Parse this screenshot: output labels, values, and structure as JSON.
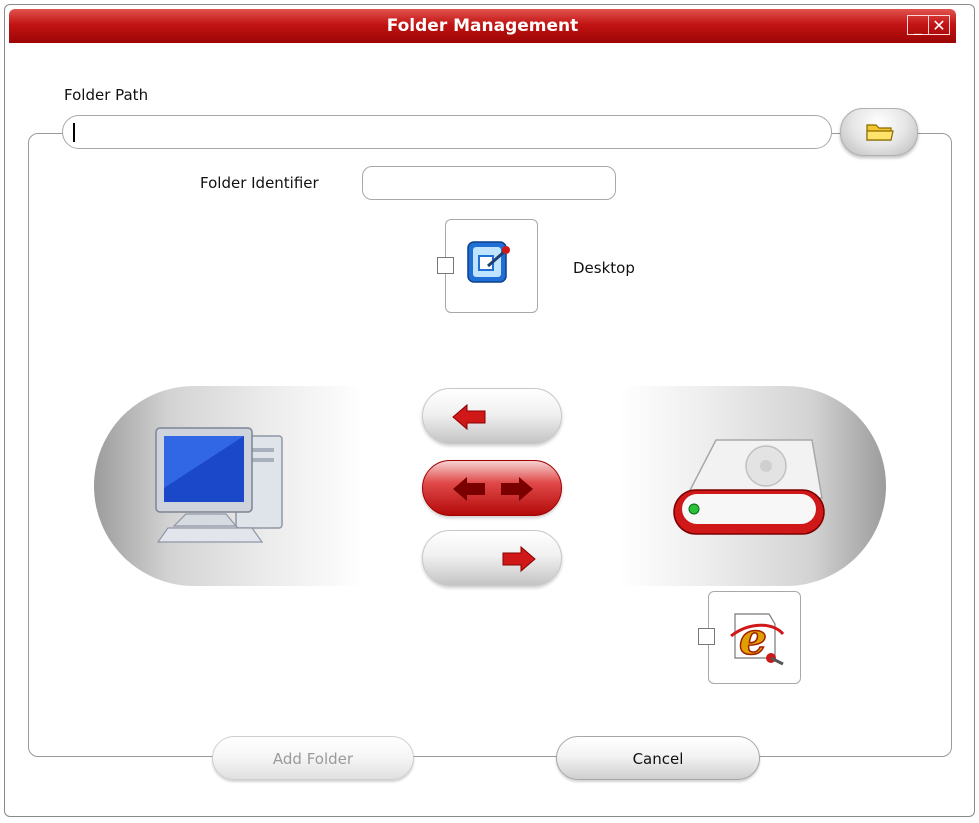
{
  "window": {
    "title": "Folder Management",
    "minimize_glyph": "_",
    "close_glyph": "✕"
  },
  "folder_path": {
    "label": "Folder Path",
    "value": ""
  },
  "folder_identifier": {
    "label": "Folder Identifier",
    "value": ""
  },
  "desktop_option": {
    "label": "Desktop",
    "checked": false
  },
  "sync_controls": {
    "left_device_icon": "desktop-computer-icon",
    "right_device_icon": "external-drive-icon",
    "buttons": [
      {
        "id": "sync-to-pc",
        "icon": "arrow-left-icon"
      },
      {
        "id": "sync-both",
        "icon": "arrow-both-icon",
        "active": true
      },
      {
        "id": "sync-to-drive",
        "icon": "arrow-right-icon"
      }
    ]
  },
  "ie_option": {
    "icon": "internet-explorer-icon",
    "checked": false
  },
  "footer": {
    "add_folder_label": "Add Folder",
    "cancel_label": "Cancel"
  },
  "colors": {
    "title_bar": "#c21414",
    "accent_red": "#d01818"
  }
}
